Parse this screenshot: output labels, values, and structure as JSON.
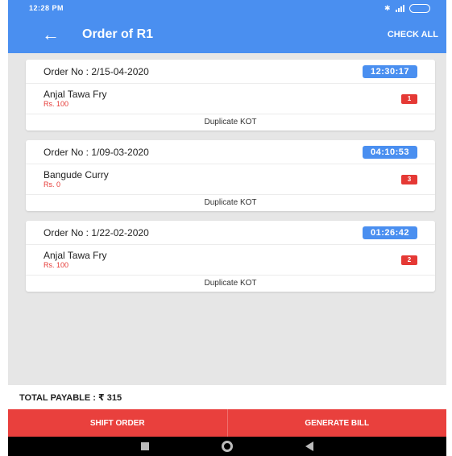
{
  "status_bar": {
    "time": "12:28 PM"
  },
  "app_bar": {
    "back_icon": "arrow-left-icon",
    "title": "Order of R1",
    "check_all": "CHECK ALL"
  },
  "orders": [
    {
      "order_no": "Order No : 2/15-04-2020",
      "time": "12:30:17",
      "item_name": "Anjal Tawa Fry",
      "item_price": "Rs. 100",
      "qty": "1",
      "duplicate_kot": "Duplicate KOT"
    },
    {
      "order_no": "Order No : 1/09-03-2020",
      "time": "04:10:53",
      "item_name": "Bangude Curry",
      "item_price": "Rs. 0",
      "qty": "3",
      "duplicate_kot": "Duplicate KOT"
    },
    {
      "order_no": "Order No : 1/22-02-2020",
      "time": "01:26:42",
      "item_name": "Anjal Tawa Fry",
      "item_price": "Rs. 100",
      "qty": "2",
      "duplicate_kot": "Duplicate KOT"
    }
  ],
  "total": {
    "label": "TOTAL PAYABLE : ₹ 315"
  },
  "actions": {
    "shift_order": "SHIFT ORDER",
    "generate_bill": "GENERATE BILL"
  },
  "colors": {
    "primary": "#4a8ff0",
    "accent": "#e9403d",
    "price": "#e53935"
  }
}
